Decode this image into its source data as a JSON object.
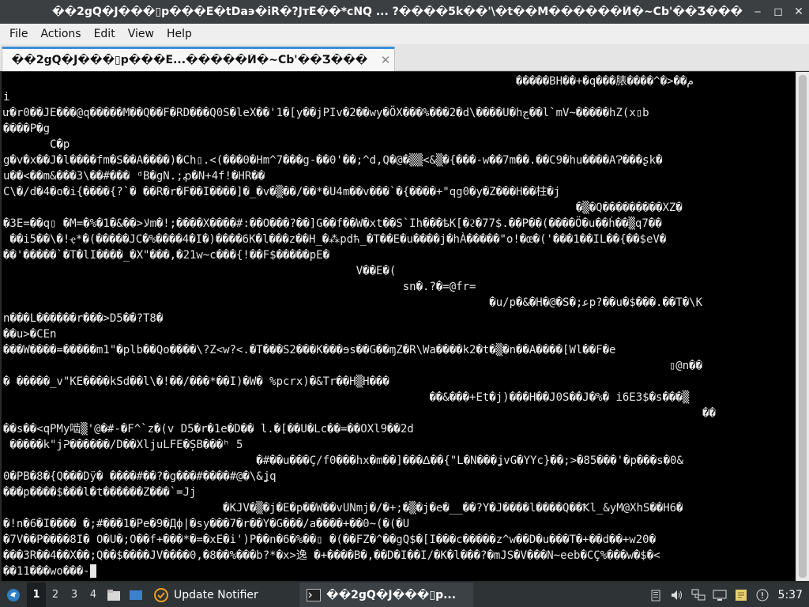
{
  "window": {
    "title": "��2gQ�J���▯p���E�tDa϶�iR�?JтE��*cNQ ...  ?����5k��'\\�t��M������Й�~Cb'��Ʒ���",
    "minimize_glyph": "‒",
    "maximize_glyph": "◻",
    "close_glyph": "✕"
  },
  "menubar": {
    "items": [
      "File",
      "Actions",
      "Edit",
      "View",
      "Help"
    ]
  },
  "tab": {
    "label": "��2gQ�J���▯p���E...�����Й�~Cb'��Ʒ���",
    "close_glyph": "✕"
  },
  "terminal": {
    "lines": [
      "                                                                             �����BH��+�q���脿����^�>��م",
      "i",
      "ư�r0��JE���@q�����M��Q��F�RD���Q0S�leX��'1�[y��jPIv�2��wy�ÖX���%���2�d\\����U�hڃ��l`mV~�����hZ(x▯b",
      "����P�g",
      "       C�p",
      "g�v�x��J�l����fm�S��A����)�Ch▯.<(���0�Hm^7���g-��0'��;^d,Q�@�▒▒<&▒�{���-w��7m��.��C9�hu����AɁ���ʂk�",
      "u��<��m&���3\\��#��� ᵈB�gN.;ꝓ�N+4f!�HR��",
      "C\\�/d�4�o�i{����{?`� ��R�r�F��I����]�_�v�▒��/��*�U4m��v���`�{����+\"qg0�y�Z���H��柱�j",
      "                                                                                      �▒�Q���������XZ�",
      "�3E=��q▯ �M=�%�1�&��>ﻻm�!;����X����#:��O���?��]G��f��W�xt��S`Ih���ѣK[�ϩ�77$.��P��(����Ö�u��ḣ��▒q7��",
      " ��i5��\\�!ҿ*�(�����JC�%����4�I�)����6K�l���z��H_�⁂pdћ_�T��E�u����j�hÀ�����\"o!�œ�('���1��IL��{��$eV�",
      "��'�����`�T�lI����_�X\"���,�21w~c���{!��F$�����pE�",
      "                                                     V��E�(",
      "                                                            sn�.?�=@fr=",
      "                                                                         �u/p�&�H�@�S�;ﻋp?��u�$���.��T�\\K",
      "n���L������r���>D5��?T8�",
      "��u>�CEn",
      "���W����=�����m1\"�plb��Qo����\\?Z<w?<.�T���S2���K���ɘs��G��ɱZ�R\\Wa����k2�t�▒�n��A����[Wl��F�e",
      "                                                                                                    ▯@n��",
      "� �����_v\"KE����kSd��l\\�!��/���*��I)�W� %pcrx)�&Tr��H▒H���",
      "                                                                ��&���+Et�j)���H��J0S��J�%� i6E3$�s���▒",
      "                                                                                                         ��",
      "��s��<qPMy啮▒'@�#-�F^`z�(v D5�r�1e�D�� l.�[��U�Lc��=��OXl9��2d",
      " �����k\"jᕈ������/D��XljuLFE�ȘB���ʰ 5",
      "                                      �#��u���Ç/f0���hx�m��]���ᐃ��{\"L�N���ʝvG�YYc}��;>�85���'�p���s�0&",
      "0�PB�8�{Q���Dÿ� ����#��?�g���#����#@�\\&ʝq",
      "���p����$���l�t������Z���`=Jj",
      "                                 �KJV�▒�j�E�p��W��vUNmj�/�+;�▒�j�e�__��?Y�J����l����Q��Ꝁl_&yM@XhS��H6�",
      "�!n�6�I���� �;#���1�Pe�9�Дф|�sy���7�r��Y�G���/a����+��0~(�(�U",
      "�7V��P����8I� O�U�;O��f+���*�=�xE�i')P��n�6�%��▯ �(��FZ�^��gQ$�[I���c�����z^w��D�u���T�+��d��+w20�",
      "���3R��4��X��;Q��$����JV����0,�8��%���b?*�x>逸 �+����B�,��D�I��I/�K�l���?�mJS�V���N~eeb�CÇ%���w�$�<",
      "��11���wo���-"
    ]
  },
  "taskbar": {
    "workspaces": [
      "1",
      "2",
      "3",
      "4"
    ],
    "active_workspace": "1",
    "update_notifier_label": "Update Notifier",
    "terminal_task_label": "��2gQ�J���▯p...",
    "clock": "5:37"
  }
}
